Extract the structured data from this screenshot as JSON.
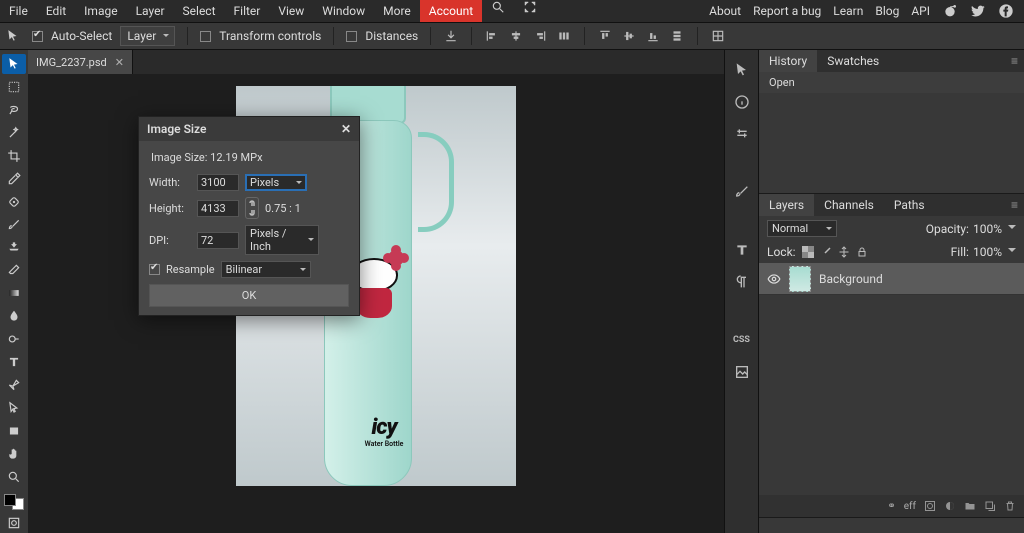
{
  "menu": {
    "file": "File",
    "edit": "Edit",
    "image": "Image",
    "layer": "Layer",
    "select": "Select",
    "filter": "Filter",
    "view": "View",
    "window": "Window",
    "more": "More",
    "account": "Account"
  },
  "topright": {
    "about": "About",
    "reportbug": "Report a bug",
    "learn": "Learn",
    "blog": "Blog",
    "api": "API"
  },
  "optbar": {
    "autoselect": "Auto-Select",
    "layer": "Layer",
    "transform": "Transform controls",
    "distances": "Distances"
  },
  "doc": {
    "tabname": "IMG_2237.psd",
    "logotext": "icy",
    "logosub": "Water Bottle"
  },
  "dialog": {
    "title": "Image Size",
    "summary": "Image Size: 12.19 MPx",
    "width_lbl": "Width:",
    "width": "3100",
    "width_unit": "Pixels",
    "height_lbl": "Height:",
    "height": "4133",
    "ratio": "0.75 : 1",
    "dpi_lbl": "DPI:",
    "dpi": "72",
    "dpi_unit": "Pixels / Inch",
    "resample": "Resample",
    "resample_method": "Bilinear",
    "ok": "OK"
  },
  "history": {
    "tab1": "History",
    "tab2": "Swatches",
    "line": "Open"
  },
  "layers": {
    "tab1": "Layers",
    "tab2": "Channels",
    "tab3": "Paths",
    "blend": "Normal",
    "opacity_lbl": "Opacity:",
    "opacity": "100%",
    "lock_lbl": "Lock:",
    "fill_lbl": "Fill:",
    "fill": "100%",
    "bgname": "Background",
    "foot_eff": "eff"
  }
}
